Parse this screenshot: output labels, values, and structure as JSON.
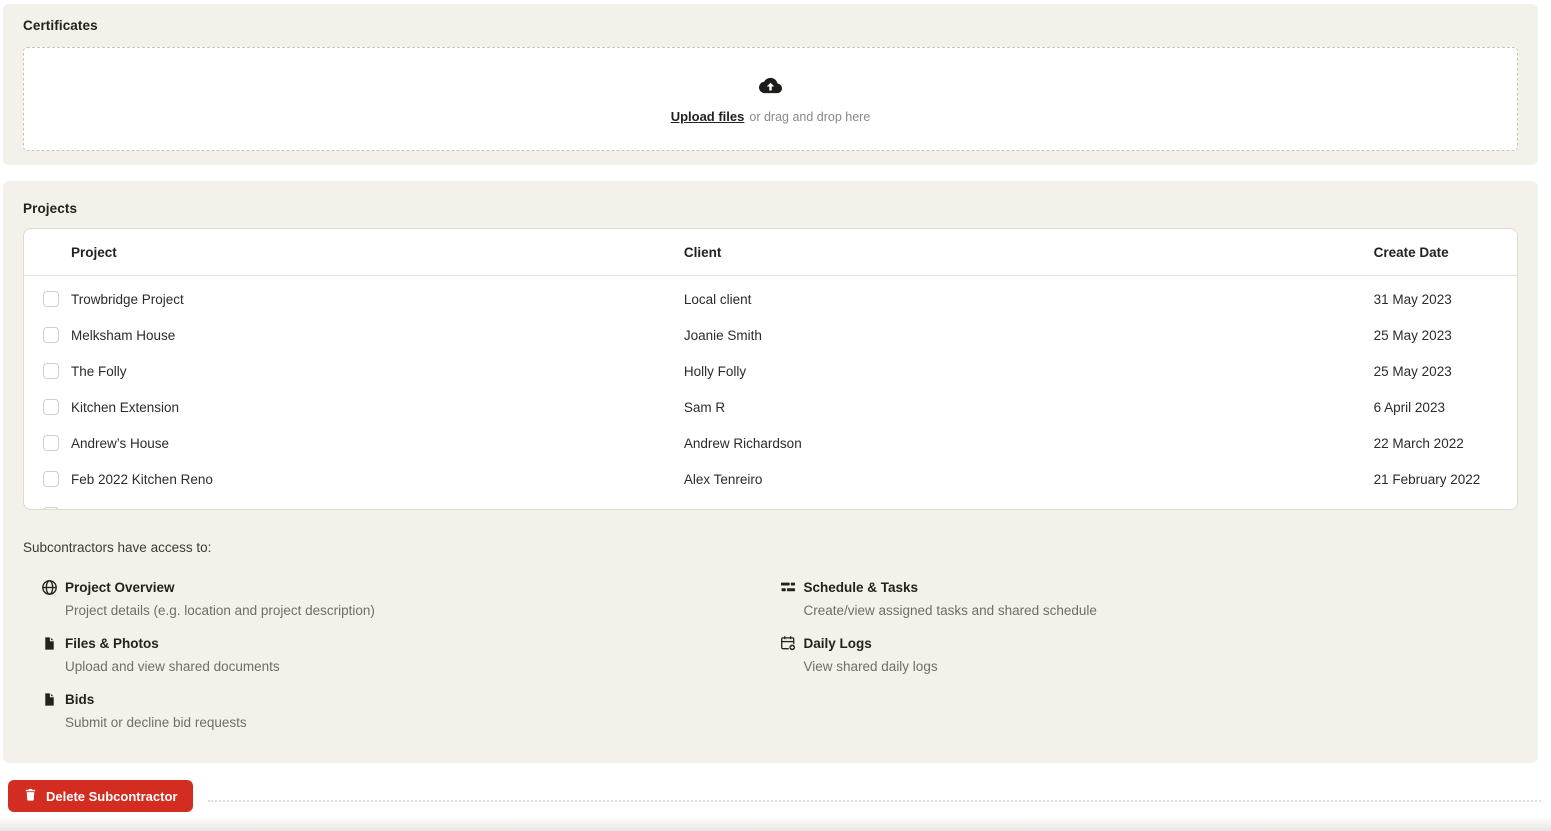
{
  "certificates": {
    "title": "Certificates",
    "upload": {
      "icon": "cloud-upload-icon",
      "link_label": "Upload files",
      "hint": "or drag and drop here"
    }
  },
  "projects": {
    "title": "Projects",
    "table": {
      "columns": [
        "Project",
        "Client",
        "Create Date"
      ],
      "rows": [
        {
          "project": "Trowbridge Project",
          "client": "Local client",
          "create_date": "31 May 2023",
          "checked": false
        },
        {
          "project": "Melksham House",
          "client": "Joanie Smith",
          "create_date": "25 May 2023",
          "checked": false
        },
        {
          "project": "The Folly",
          "client": "Holly Folly",
          "create_date": "25 May 2023",
          "checked": false
        },
        {
          "project": "Kitchen Extension",
          "client": "Sam R",
          "create_date": "6 April 2023",
          "checked": false
        },
        {
          "project": "Andrew’s House",
          "client": "Andrew Richardson",
          "create_date": "22 March 2022",
          "checked": false
        },
        {
          "project": "Feb 2022 Kitchen Reno",
          "client": "Alex Tenreiro",
          "create_date": "21 February 2022",
          "checked": false
        }
      ],
      "partial_row_visible": true
    }
  },
  "access": {
    "heading": "Subcontractors have access to:",
    "items": [
      {
        "icon": "globe-icon",
        "title": "Project Overview",
        "description": "Project details (e.g. location and project description)",
        "column": "left"
      },
      {
        "icon": "file-icon",
        "title": "Files & Photos",
        "description": "Upload and view shared documents",
        "column": "left"
      },
      {
        "icon": "file-icon",
        "title": "Bids",
        "description": "Submit or decline bid requests",
        "column": "left"
      },
      {
        "icon": "schedule-icon",
        "title": "Schedule & Tasks",
        "description": "Create/view assigned tasks and shared schedule",
        "column": "right"
      },
      {
        "icon": "calendar-add-icon",
        "title": "Daily Logs",
        "description": "View shared daily logs",
        "column": "right"
      }
    ]
  },
  "actions": {
    "delete_label": "Delete Subcontractor",
    "delete_icon": "trash-icon"
  },
  "colors": {
    "card_background": "#f3f1ea",
    "danger": "#d32d22",
    "text_primary": "#23221f",
    "text_secondary": "#6f6e68",
    "table_border": "#dedbd2"
  }
}
